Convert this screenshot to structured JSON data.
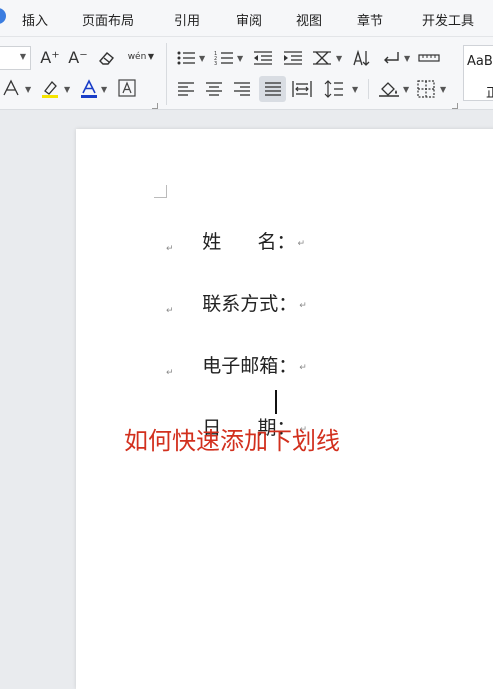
{
  "menu": {
    "items": [
      "插入",
      "页面布局",
      "引用",
      "审阅",
      "视图",
      "章节",
      "开发工具"
    ]
  },
  "ribbon": {
    "font_size_up": "A⁺",
    "font_size_down": "A⁻",
    "phonetic": "wén",
    "style_preview": "AaB",
    "style_preview_sub": "正"
  },
  "document": {
    "lines": [
      {
        "text": "姓      名："
      },
      {
        "text": "联系方式："
      },
      {
        "text": "电子邮箱："
      },
      {
        "text": "日      期："
      }
    ],
    "paragraph_mark": "↵",
    "caption": "如何快速添加下划线"
  },
  "colors": {
    "accent": "#3b7de0",
    "caption": "#d2301e",
    "highlight": "#f5e400",
    "font_color": "#1a3ec8"
  }
}
